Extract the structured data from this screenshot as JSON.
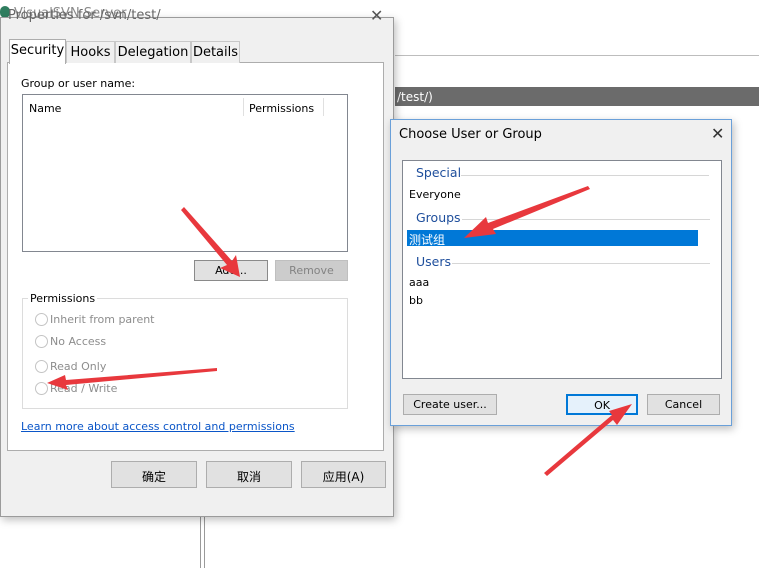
{
  "background": {
    "app_title": "VisualSVN Server",
    "repo_path": "/test/)"
  },
  "properties_dialog": {
    "title": "Properties for /svn/test/",
    "close_glyph": "✕",
    "tabs": [
      {
        "label": "Security",
        "active": true
      },
      {
        "label": "Hooks"
      },
      {
        "label": "Delegation"
      },
      {
        "label": "Details"
      }
    ],
    "group_label": "Group or user name:",
    "columns": [
      "Name",
      "Permissions"
    ],
    "add_button": "Add...",
    "remove_button": "Remove",
    "permissions": {
      "legend": "Permissions",
      "options": [
        "Inherit from parent",
        "No Access",
        "Read Only",
        "Read / Write"
      ]
    },
    "learn_more_link": "Learn more about access control and permissions",
    "buttons": {
      "ok": "确定",
      "cancel": "取消",
      "apply": "应用(A)"
    }
  },
  "choose_dialog": {
    "title": "Choose User or Group",
    "close_glyph": "✕",
    "sections": {
      "special": {
        "header": "Special",
        "items": [
          "Everyone"
        ]
      },
      "groups": {
        "header": "Groups",
        "items": [
          "测试组"
        ],
        "selected": "测试组"
      },
      "users": {
        "header": "Users",
        "items": [
          "aaa",
          "bb"
        ]
      }
    },
    "create_user_button": "Create user...",
    "ok_button": "OK",
    "cancel_button": "Cancel"
  },
  "colors": {
    "selection": "#0078d7",
    "link": "#0b56c8",
    "header_blue": "#1e4e9c",
    "annotation_arrow": "#e8383d"
  }
}
